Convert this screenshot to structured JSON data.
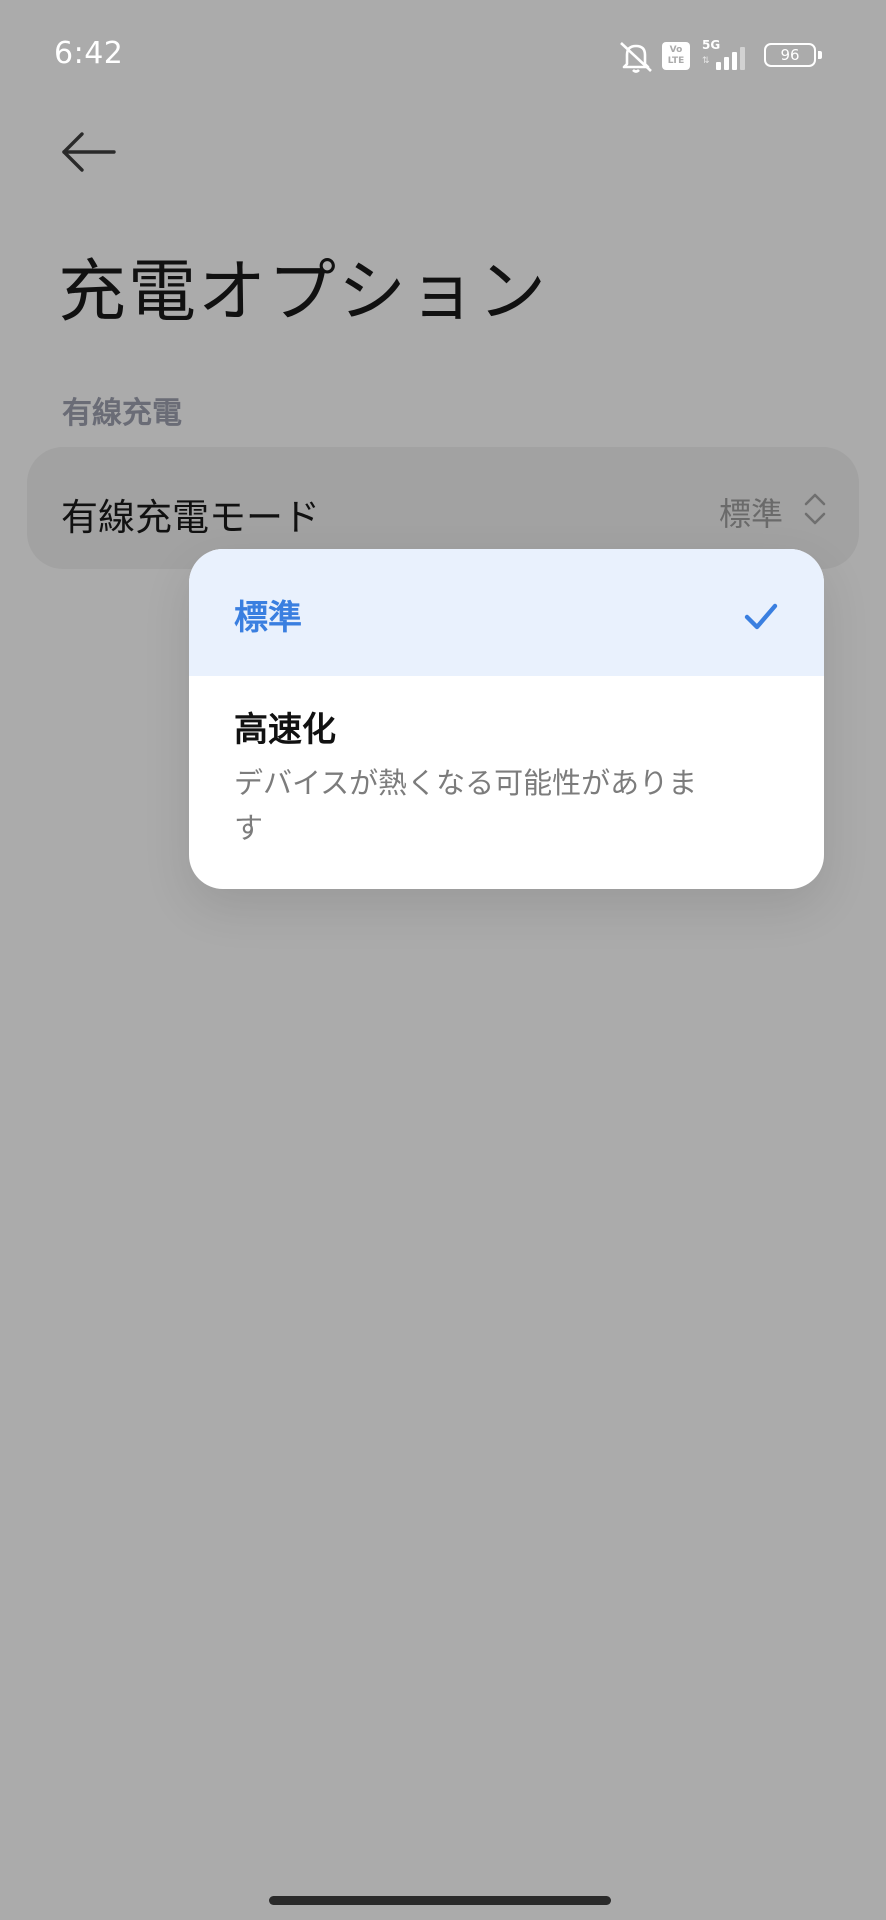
{
  "status_bar": {
    "time": "6:42",
    "network_badge_top": "Vo",
    "network_badge_bottom": "LTE",
    "network_type": "5G",
    "battery_level": "96",
    "icons": [
      "muted-bell-icon",
      "volte-icon",
      "signal-5g-icon",
      "battery-icon"
    ]
  },
  "header": {
    "back_icon": "arrow-left-icon",
    "title": "充電オプション"
  },
  "section": {
    "header": "有線充電"
  },
  "setting": {
    "label": "有線充電モード",
    "value": "標準",
    "icon": "chevron-up-down-icon"
  },
  "popup": {
    "options": [
      {
        "label": "標準",
        "selected": true,
        "icon": "check-icon"
      },
      {
        "label": "高速化",
        "description": "デバイスが熱くなる可能性があります",
        "selected": false
      }
    ]
  },
  "colors": {
    "scrim_background": "#ababab",
    "accent": "#3a7fe0",
    "selected_row_background": "#e9f1fd",
    "popup_background": "#ffffff",
    "section_header": "#6a6c76"
  }
}
